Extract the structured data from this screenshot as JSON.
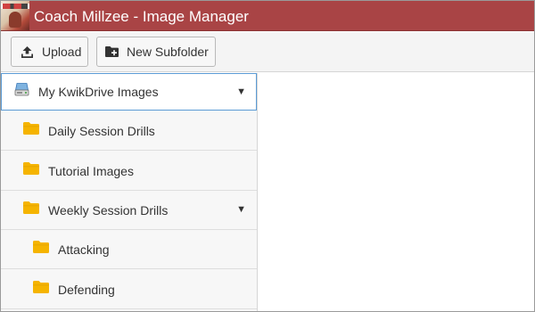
{
  "titlebar": {
    "title": "Coach Millzee - Image Manager",
    "logo_icon": "team-logo-icon",
    "background": "#a94445"
  },
  "toolbar": {
    "upload_label": "Upload",
    "upload_icon": "upload-icon",
    "new_subfolder_label": "New Subfolder",
    "new_subfolder_icon": "folder-plus-icon"
  },
  "tree": {
    "root": {
      "label": "My KwikDrive Images",
      "icon": "drive-icon",
      "expanded": true,
      "selected": true
    },
    "items": [
      {
        "label": "Daily Session Drills",
        "icon": "folder-icon",
        "level": 1,
        "expanded": false
      },
      {
        "label": "Tutorial Images",
        "icon": "folder-icon",
        "level": 1,
        "expanded": false
      },
      {
        "label": "Weekly Session Drills",
        "icon": "folder-icon",
        "level": 1,
        "expanded": true
      },
      {
        "label": "Attacking",
        "icon": "folder-icon",
        "level": 2,
        "expanded": false
      },
      {
        "label": "Defending",
        "icon": "folder-icon",
        "level": 2,
        "expanded": false
      }
    ],
    "folder_color": "#f5b400",
    "selection_border": "#5b9bd5"
  },
  "content": {}
}
